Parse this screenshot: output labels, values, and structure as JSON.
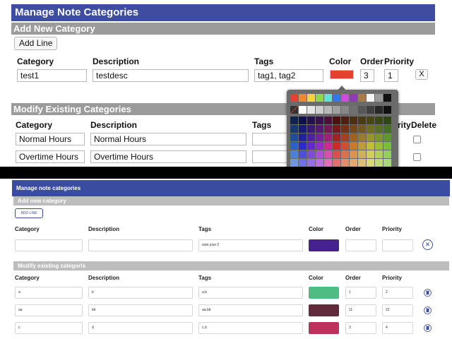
{
  "old": {
    "title": "Manage Note Categories",
    "add_section": "Add New Category",
    "add_line_label": "Add Line",
    "headers": {
      "category": "Category",
      "description": "Description",
      "tags": "Tags",
      "color": "Color",
      "order": "Order",
      "priority": "Priority"
    },
    "new_row": {
      "category": "test1",
      "description": "testdesc",
      "tags": "tag1, tag2",
      "color": "#e8402f",
      "order": "3",
      "priority": "1",
      "remove_label": "X"
    },
    "modify_section": "Modify Existing Categories",
    "modify_headers": {
      "category": "Category",
      "description": "Description",
      "tags": "Tags",
      "priority": "rity",
      "delete": "Delete"
    },
    "rows": [
      {
        "category": "Normal Hours",
        "description": "Normal Hours"
      },
      {
        "category": "Overtime Hours",
        "description": "Overtime Hours"
      }
    ]
  },
  "new": {
    "title": "Manage note categories",
    "add_section": "Add new category",
    "add_line_label": "ADD LINE",
    "headers": {
      "category": "Category",
      "description": "Description",
      "tags": "Tags",
      "color": "Color",
      "order": "Order",
      "priority": "Priority"
    },
    "new_row": {
      "category": "",
      "description": "",
      "tags": "stan jose 2",
      "color": "#45228f",
      "order": "",
      "priority": ""
    },
    "modify_section": "Modify existing categoris",
    "rows": [
      {
        "category": "a",
        "description": "b",
        "tags": "a,b",
        "color": "#4dbd83",
        "order": "1",
        "priority": "2"
      },
      {
        "category": "aa",
        "description": "bb",
        "tags": "aa,bb",
        "color": "#622b3c",
        "order": "11",
        "priority": "22"
      },
      {
        "category": "c",
        "description": "d",
        "tags": "c,d",
        "color": "#bd315c",
        "order": "3",
        "priority": "4"
      }
    ]
  },
  "icons": {
    "remove": "close-circle-icon",
    "delete": "trash-icon"
  }
}
